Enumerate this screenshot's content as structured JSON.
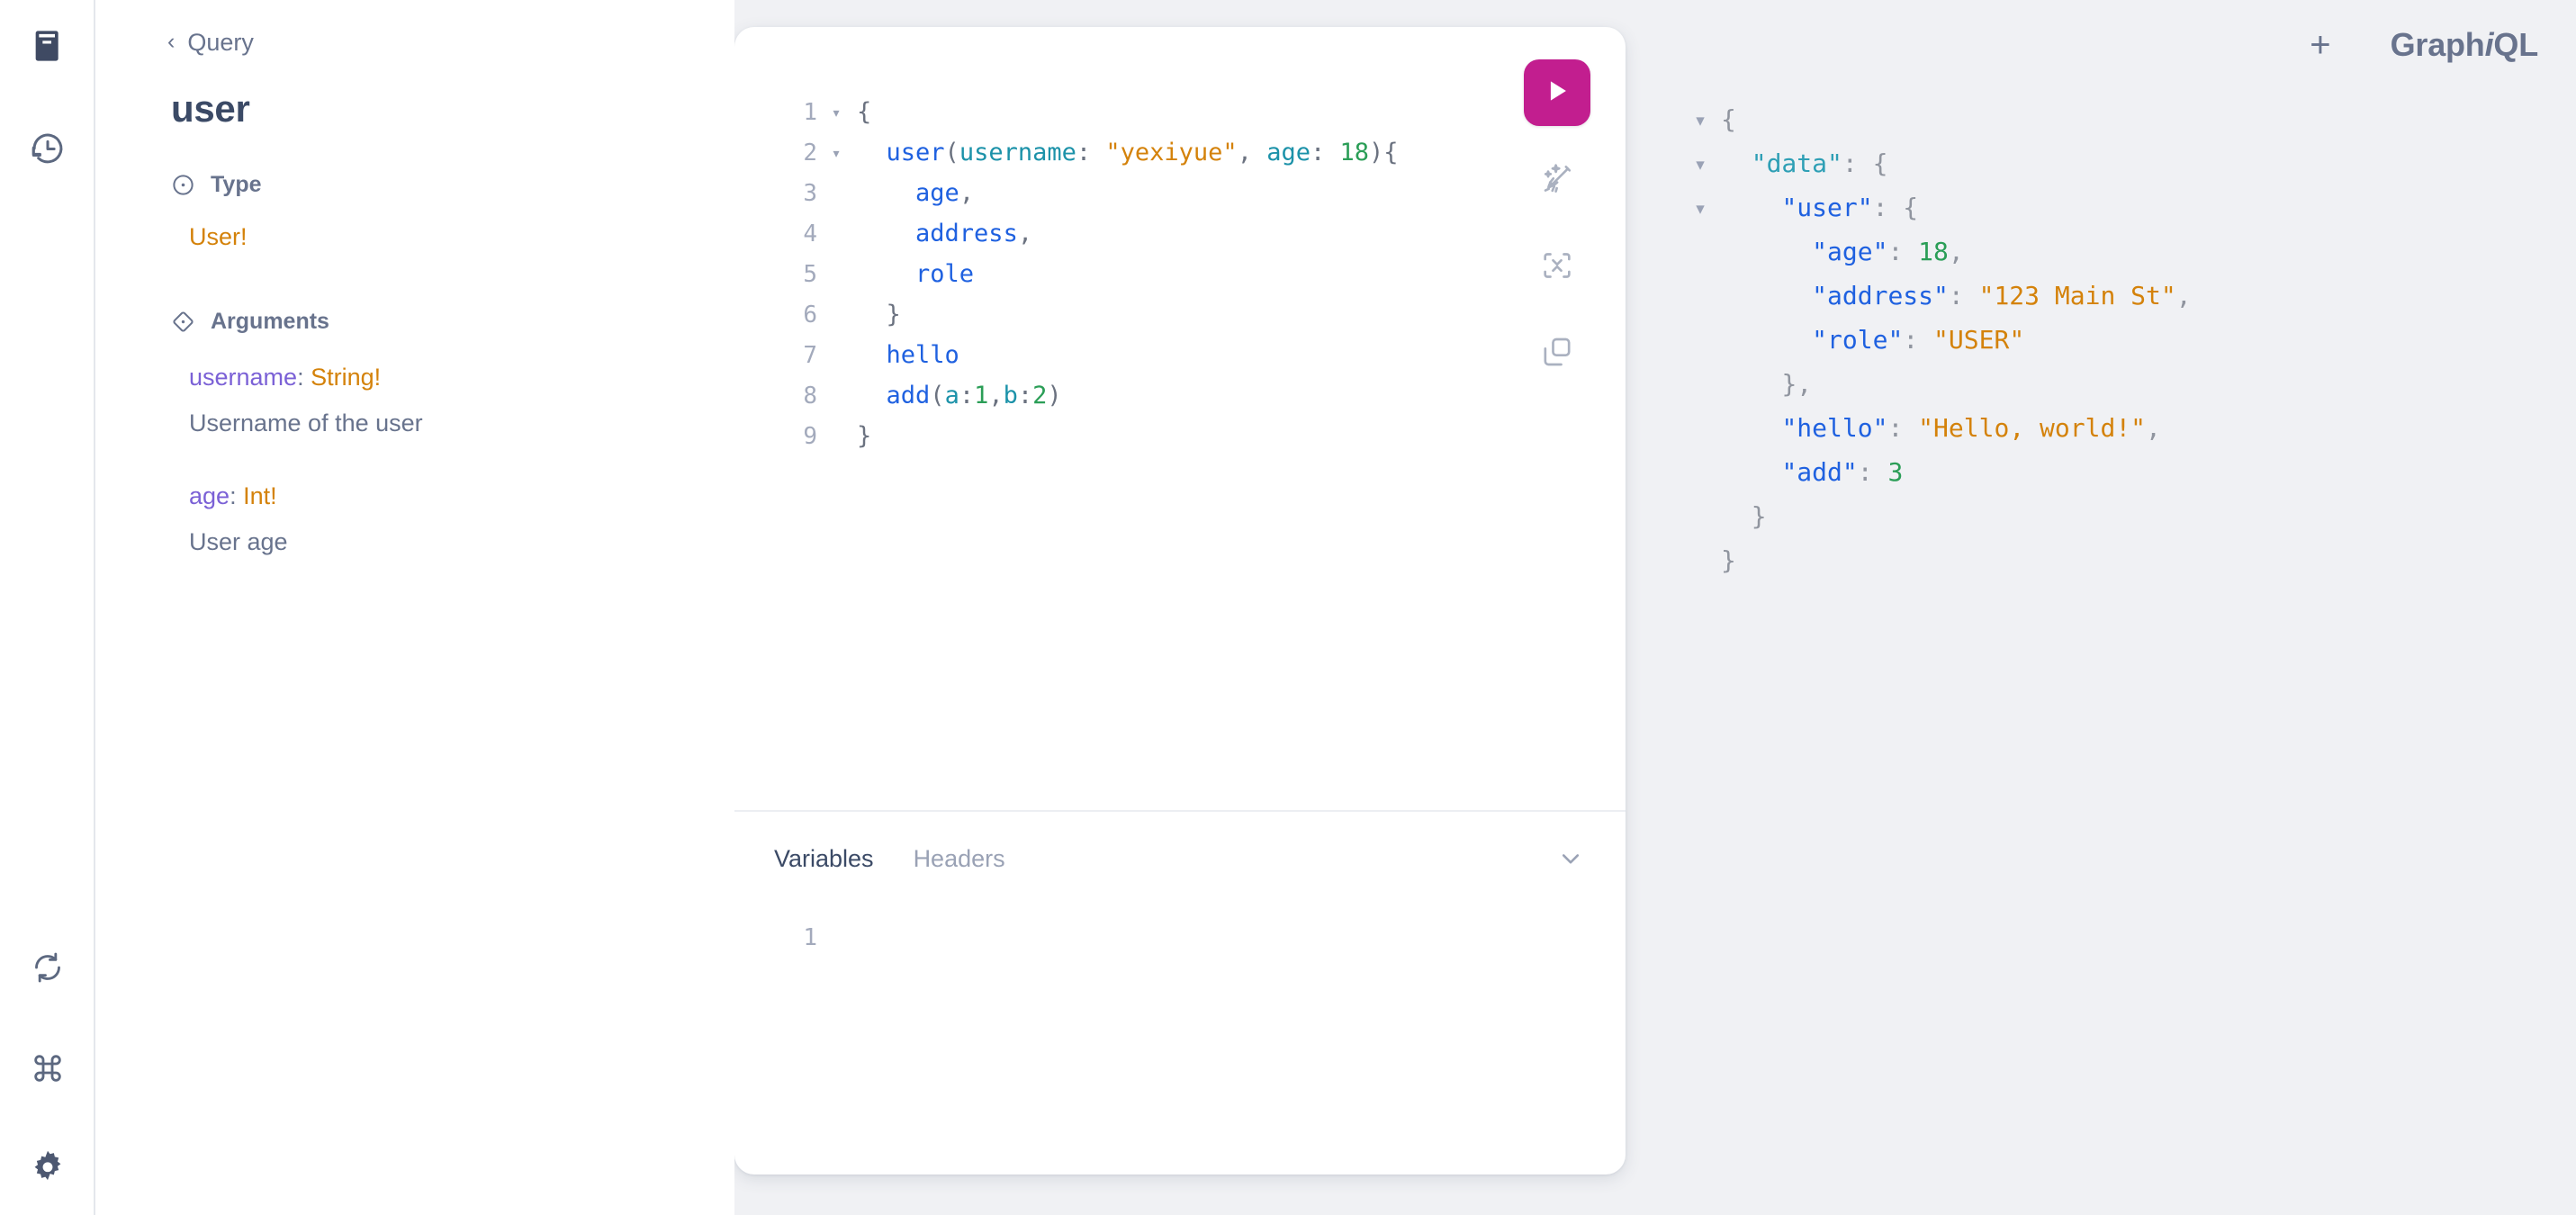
{
  "rail": {
    "items": [
      {
        "name": "docs-icon",
        "label": "Show Documentation Explorer",
        "active": true
      },
      {
        "name": "history-icon",
        "label": "Show History",
        "active": false
      },
      {
        "name": "refresh-icon",
        "label": "Re-fetch GraphQL schema",
        "active": false
      },
      {
        "name": "shortcuts-icon",
        "label": "Open short keys dialog",
        "active": false
      },
      {
        "name": "settings-icon",
        "label": "Open settings dialog",
        "active": false
      }
    ]
  },
  "docs": {
    "back_chevron": "‹",
    "breadcrumb": "Query",
    "title": "user",
    "type_section": {
      "heading": "Type",
      "icon": "type-circle-icon",
      "value": "User!"
    },
    "arguments_section": {
      "heading": "Arguments",
      "icon": "arguments-diamond-icon",
      "args": [
        {
          "name": "username",
          "sep": ": ",
          "type": "String!",
          "description": "Username of the user"
        },
        {
          "name": "age",
          "sep": ": ",
          "type": "Int!",
          "description": "User age"
        }
      ]
    }
  },
  "header": {
    "plus_label": "+",
    "logo_prefix": "Graph",
    "logo_italic": "i",
    "logo_suffix": "QL"
  },
  "toolbar": {
    "execute": {
      "name": "execute-query-button",
      "icon": "play-icon",
      "color": "#c21e8f"
    },
    "prettify": {
      "name": "prettify-button",
      "icon": "broom-sparkles-icon"
    },
    "merge": {
      "name": "merge-fragments-button",
      "icon": "merge-collapse-icon"
    },
    "copy": {
      "name": "copy-query-button",
      "icon": "copy-icon"
    }
  },
  "query_editor": {
    "lines": [
      {
        "num": "1",
        "fold": "▾",
        "tokens": [
          {
            "t": "punct",
            "v": "{"
          }
        ]
      },
      {
        "num": "2",
        "fold": "▾",
        "tokens": [
          {
            "t": "plain",
            "v": "  "
          },
          {
            "t": "field",
            "v": "user"
          },
          {
            "t": "punct",
            "v": "("
          },
          {
            "t": "arg",
            "v": "username"
          },
          {
            "t": "punct",
            "v": ": "
          },
          {
            "t": "string",
            "v": "\"yexiyue\""
          },
          {
            "t": "punct",
            "v": ", "
          },
          {
            "t": "arg",
            "v": "age"
          },
          {
            "t": "punct",
            "v": ": "
          },
          {
            "t": "number",
            "v": "18"
          },
          {
            "t": "punct",
            "v": "){"
          }
        ]
      },
      {
        "num": "3",
        "fold": "",
        "tokens": [
          {
            "t": "plain",
            "v": "    "
          },
          {
            "t": "field",
            "v": "age"
          },
          {
            "t": "punct",
            "v": ","
          }
        ]
      },
      {
        "num": "4",
        "fold": "",
        "tokens": [
          {
            "t": "plain",
            "v": "    "
          },
          {
            "t": "field",
            "v": "address"
          },
          {
            "t": "punct",
            "v": ","
          }
        ]
      },
      {
        "num": "5",
        "fold": "",
        "tokens": [
          {
            "t": "plain",
            "v": "    "
          },
          {
            "t": "field",
            "v": "role"
          }
        ]
      },
      {
        "num": "6",
        "fold": "",
        "tokens": [
          {
            "t": "plain",
            "v": "  "
          },
          {
            "t": "punct",
            "v": "}"
          }
        ]
      },
      {
        "num": "7",
        "fold": "",
        "tokens": [
          {
            "t": "plain",
            "v": "  "
          },
          {
            "t": "field",
            "v": "hello"
          }
        ]
      },
      {
        "num": "8",
        "fold": "",
        "tokens": [
          {
            "t": "plain",
            "v": "  "
          },
          {
            "t": "field",
            "v": "add"
          },
          {
            "t": "punct",
            "v": "("
          },
          {
            "t": "arg",
            "v": "a"
          },
          {
            "t": "punct",
            "v": ":"
          },
          {
            "t": "number",
            "v": "1"
          },
          {
            "t": "punct",
            "v": ","
          },
          {
            "t": "arg",
            "v": "b"
          },
          {
            "t": "punct",
            "v": ":"
          },
          {
            "t": "number",
            "v": "2"
          },
          {
            "t": "punct",
            "v": ")"
          }
        ]
      },
      {
        "num": "9",
        "fold": "",
        "tokens": [
          {
            "t": "punct",
            "v": "}"
          }
        ]
      }
    ]
  },
  "variables_pane": {
    "tabs": [
      {
        "label": "Variables",
        "active": true
      },
      {
        "label": "Headers",
        "active": false
      }
    ],
    "collapse_icon": "chevron-down-icon",
    "line_number": "1",
    "content": ""
  },
  "result_pane": {
    "lines": [
      {
        "fold": "▾",
        "tokens": [
          {
            "t": "punct",
            "v": "{"
          }
        ]
      },
      {
        "fold": "▾",
        "tokens": [
          {
            "t": "plain",
            "v": "  "
          },
          {
            "t": "key1",
            "v": "\"data\""
          },
          {
            "t": "punct",
            "v": ": {"
          }
        ]
      },
      {
        "fold": "▾",
        "tokens": [
          {
            "t": "plain",
            "v": "    "
          },
          {
            "t": "key",
            "v": "\"user\""
          },
          {
            "t": "punct",
            "v": ": {"
          }
        ]
      },
      {
        "fold": "",
        "tokens": [
          {
            "t": "plain",
            "v": "      "
          },
          {
            "t": "key",
            "v": "\"age\""
          },
          {
            "t": "punct",
            "v": ": "
          },
          {
            "t": "number",
            "v": "18"
          },
          {
            "t": "punct",
            "v": ","
          }
        ]
      },
      {
        "fold": "",
        "tokens": [
          {
            "t": "plain",
            "v": "      "
          },
          {
            "t": "key",
            "v": "\"address\""
          },
          {
            "t": "punct",
            "v": ": "
          },
          {
            "t": "string",
            "v": "\"123 Main St\""
          },
          {
            "t": "punct",
            "v": ","
          }
        ]
      },
      {
        "fold": "",
        "tokens": [
          {
            "t": "plain",
            "v": "      "
          },
          {
            "t": "key",
            "v": "\"role\""
          },
          {
            "t": "punct",
            "v": ": "
          },
          {
            "t": "string",
            "v": "\"USER\""
          }
        ]
      },
      {
        "fold": "",
        "tokens": [
          {
            "t": "plain",
            "v": "    "
          },
          {
            "t": "punct",
            "v": "},"
          }
        ]
      },
      {
        "fold": "",
        "tokens": [
          {
            "t": "plain",
            "v": "    "
          },
          {
            "t": "key",
            "v": "\"hello\""
          },
          {
            "t": "punct",
            "v": ": "
          },
          {
            "t": "string",
            "v": "\"Hello, world!\""
          },
          {
            "t": "punct",
            "v": ","
          }
        ]
      },
      {
        "fold": "",
        "tokens": [
          {
            "t": "plain",
            "v": "    "
          },
          {
            "t": "key",
            "v": "\"add\""
          },
          {
            "t": "punct",
            "v": ": "
          },
          {
            "t": "number",
            "v": "3"
          }
        ]
      },
      {
        "fold": "",
        "tokens": [
          {
            "t": "plain",
            "v": "  "
          },
          {
            "t": "punct",
            "v": "}"
          }
        ]
      },
      {
        "fold": "",
        "tokens": [
          {
            "t": "punct",
            "v": "}"
          }
        ]
      }
    ]
  },
  "colors": {
    "accent_pink": "#c21e8f",
    "text_dark": "#3b4a66",
    "text_muted": "#68738d",
    "orange": "#d4820a",
    "purple": "#7b61d6",
    "blue": "#1f61e0",
    "teal": "#1c92a9",
    "green": "#2b9e57",
    "panel_bg": "#f0f1f4"
  }
}
